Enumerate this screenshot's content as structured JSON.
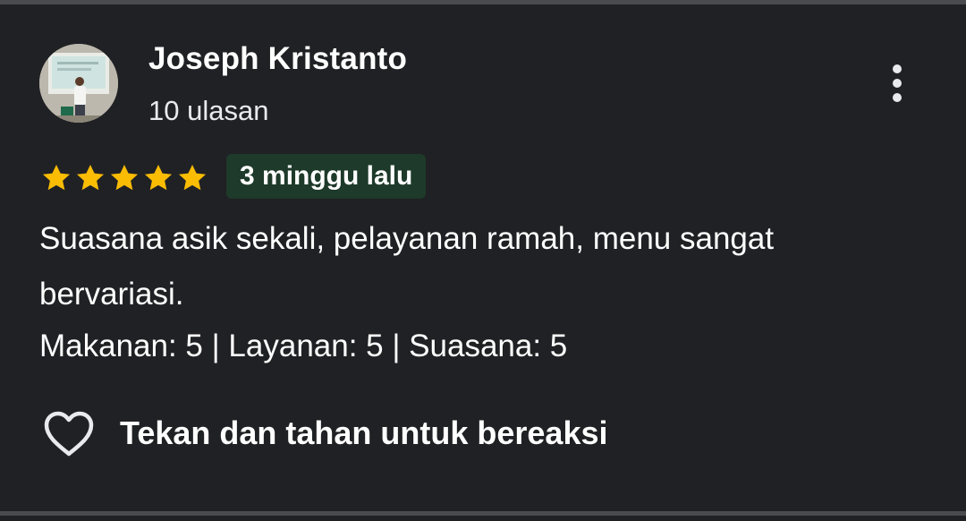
{
  "reviewer": {
    "name": "Joseph Kristanto",
    "review_count": "10 ulasan"
  },
  "review": {
    "rating": 5,
    "rating_max": 5,
    "time_ago": "3 minggu lalu",
    "text": "Suasana asik sekali, pelayanan ramah, menu sangat bervariasi.",
    "sub_ratings": "Makanan: 5 | Layanan: 5 | Suasana: 5"
  },
  "actions": {
    "react_label": "Tekan dan tahan untuk bereaksi"
  },
  "icons": {
    "more": "more-vert-icon",
    "heart": "heart-outline-icon",
    "star": "star-icon"
  },
  "colors": {
    "background": "#202124",
    "star": "#fbbc04",
    "badge_background": "#1e3a2a",
    "text": "#ffffff"
  }
}
